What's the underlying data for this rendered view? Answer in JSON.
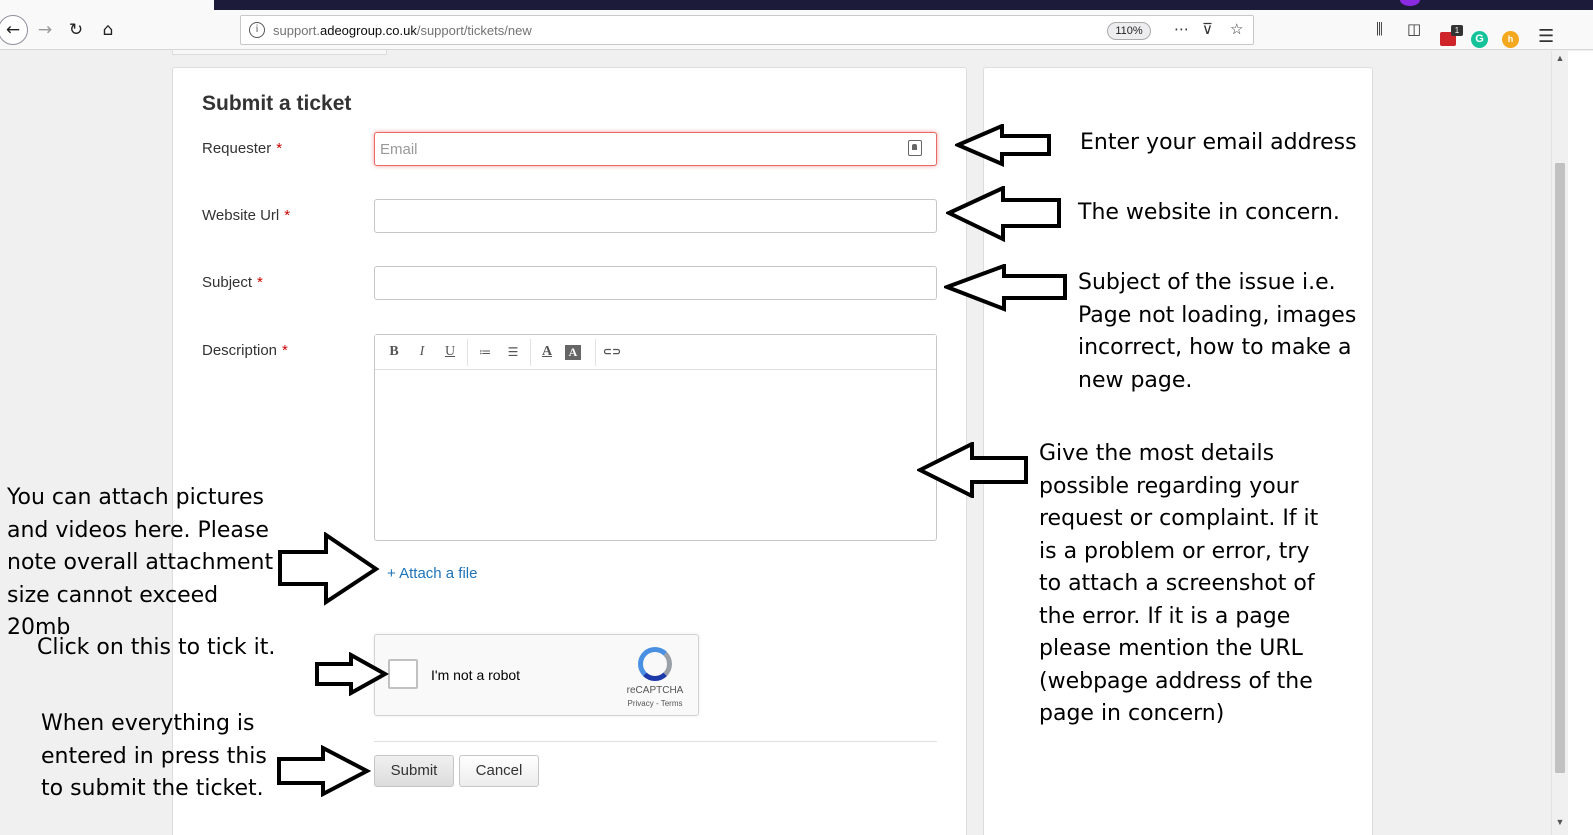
{
  "browser": {
    "url_prefix": "support.",
    "url_domain": "adeogroup.co.uk",
    "url_path": "/support/tickets/new",
    "zoom": "110%",
    "icons": [
      "back-icon",
      "forward-icon",
      "reload-icon",
      "home-icon",
      "site-info-icon",
      "more-actions-icon",
      "pocket-icon",
      "bookmark-star-icon",
      "library-icon",
      "sidebar-icon",
      "extension-red-icon",
      "grammarly-icon",
      "honey-icon",
      "menu-icon"
    ],
    "extension_badge": "1"
  },
  "form": {
    "title": "Submit a ticket",
    "required_marker": "*",
    "requester_label": "Requester",
    "email_placeholder": "Email",
    "website_label": "Website Url",
    "subject_label": "Subject",
    "description_label": "Description",
    "attach_label": "+ Attach a file",
    "submit_label": "Submit",
    "cancel_label": "Cancel"
  },
  "editor_toolbar": {
    "bold": "B",
    "italic": "I",
    "underline": "U",
    "bullets": "≔",
    "numbered": "☰",
    "font_color": "A",
    "highlight": "A",
    "link": "⊂⊃"
  },
  "recaptcha": {
    "label": "I'm not a robot",
    "brand": "reCAPTCHA",
    "links": "Privacy - Terms"
  },
  "annotations": {
    "email": "Enter your email address",
    "website": "The website in concern.",
    "subject": "Subject of the issue i.e. Page not loading, images incorrect, how to make a new page.",
    "description": "Give the most details possible regarding your request or complaint. If it is a problem or error, try to attach a screenshot of the error. If it is a page please mention the URL (webpage address of the page in concern)",
    "attach": "You can attach pictures and videos here. Please note overall attachment size cannot exceed 20mb",
    "captcha": "Click on this to tick it.",
    "submit": "When everything is entered in press this to submit the ticket."
  }
}
